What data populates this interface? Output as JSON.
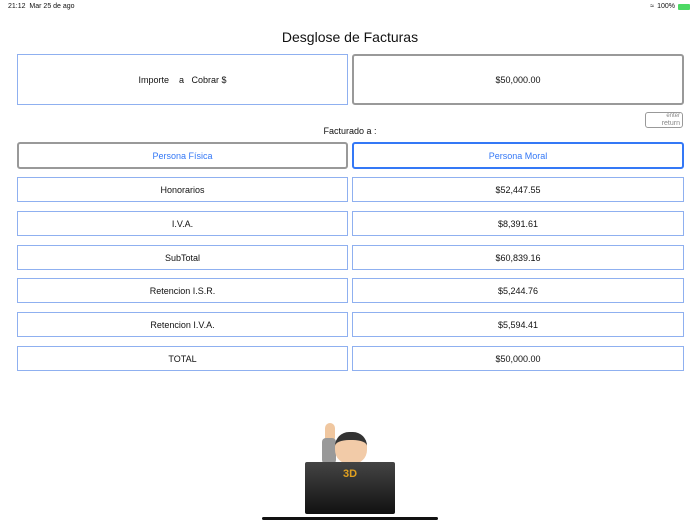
{
  "status_bar": {
    "time": "21:12",
    "date": "Mar 25 de ago",
    "battery": "100%",
    "wifi_icon": "wifi-icon",
    "battery_icon": "battery-charging-icon"
  },
  "title": "Desglose de Facturas",
  "amount": {
    "label": "Importe    a   Cobrar $",
    "value": "$50,000.00"
  },
  "keyboard_key": {
    "top": "enter",
    "bottom": "return"
  },
  "billed_to": {
    "label": "Facturado a :",
    "options": [
      "Persona Física",
      "Persona Moral"
    ],
    "selected": "Persona Moral"
  },
  "rows": [
    {
      "label": "Honorarios",
      "value": "$52,447.55"
    },
    {
      "label": "I.V.A.",
      "value": "$8,391.61"
    },
    {
      "label": "SubTotal",
      "value": "$60,839.16"
    },
    {
      "label": "Retencion I.S.R.",
      "value": "$5,244.76"
    },
    {
      "label": "Retencion I.V.A.",
      "value": "$5,594.41"
    },
    {
      "label": "TOTAL",
      "value": "$50,000.00"
    }
  ],
  "logo": "3D",
  "colors": {
    "accent": "#3478f6",
    "border": "#8fb0f0"
  }
}
